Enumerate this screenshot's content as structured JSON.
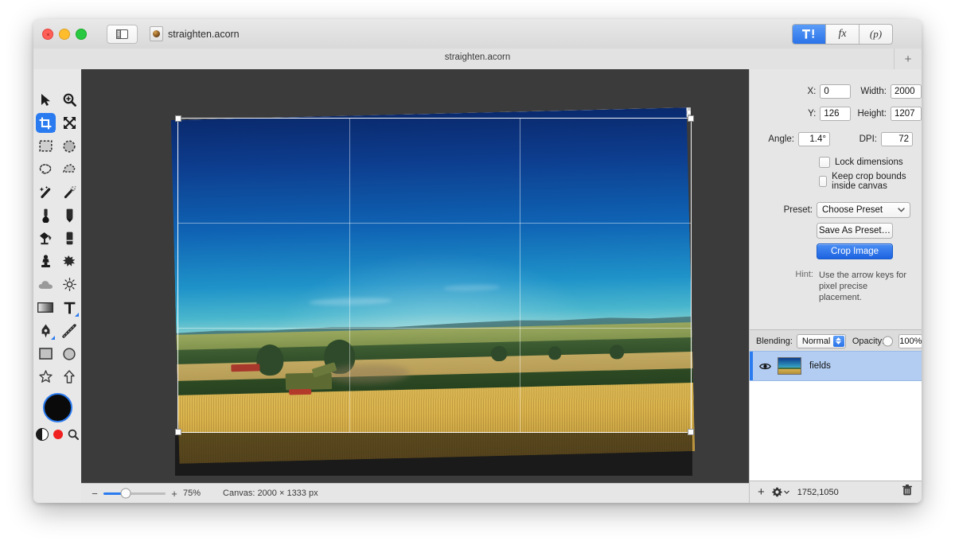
{
  "window": {
    "document_name": "straighten.acorn",
    "tab_title": "straighten.acorn",
    "add_tab_label": "+",
    "traffic_lights": [
      "close-red",
      "minimize-yellow",
      "zoom-green"
    ],
    "sidebar_toggle_icon": "sidebar-toggle-icon",
    "doc_icon": "acorn-document-icon"
  },
  "toolbar_segments": [
    {
      "name": "tools-segment",
      "glyph": "tools-icon",
      "active": true
    },
    {
      "name": "filters-segment",
      "label": "fx",
      "active": false
    },
    {
      "name": "palette-segment",
      "label": "(p)",
      "active": false
    }
  ],
  "tools": [
    {
      "name": "move-tool",
      "icon": "arrow-cursor-icon",
      "selected": false
    },
    {
      "name": "zoom-tool",
      "icon": "magnifier-plus-icon",
      "selected": false
    },
    {
      "name": "crop-tool",
      "icon": "crop-icon",
      "selected": true
    },
    {
      "name": "transform-tool",
      "icon": "four-arrows-icon",
      "selected": false
    },
    {
      "name": "rectangular-select-tool",
      "icon": "dashed-rectangle-icon",
      "selected": false
    },
    {
      "name": "elliptical-select-tool",
      "icon": "dashed-ellipse-icon",
      "selected": false
    },
    {
      "name": "lasso-tool",
      "icon": "lasso-icon",
      "selected": false
    },
    {
      "name": "polygon-lasso-tool",
      "icon": "polygon-lasso-icon",
      "selected": false
    },
    {
      "name": "magic-wand-tool",
      "icon": "magic-wand-icon",
      "selected": false
    },
    {
      "name": "instant-alpha-tool",
      "icon": "sparkle-wand-icon",
      "selected": false
    },
    {
      "name": "eyedropper-tool",
      "icon": "eyedropper-icon",
      "selected": false
    },
    {
      "name": "pencil-tool",
      "icon": "pencil-icon",
      "selected": false
    },
    {
      "name": "paint-bucket-tool",
      "icon": "paint-bucket-icon",
      "selected": false
    },
    {
      "name": "eraser-tool",
      "icon": "eraser-icon",
      "selected": false
    },
    {
      "name": "clone-stamp-tool",
      "icon": "clone-stamp-icon",
      "selected": false
    },
    {
      "name": "smudge-tool",
      "icon": "spatter-icon",
      "selected": false
    },
    {
      "name": "blur-tool",
      "icon": "cloud-icon",
      "selected": false
    },
    {
      "name": "dodge-tool",
      "icon": "sun-icon",
      "selected": false
    },
    {
      "name": "gradient-tool",
      "icon": "gradient-icon",
      "selected": false
    },
    {
      "name": "text-tool",
      "icon": "text-t-icon",
      "selected": false
    },
    {
      "name": "bezier-pen-tool",
      "icon": "pen-nib-icon",
      "selected": false
    },
    {
      "name": "line-tool",
      "icon": "line-icon",
      "selected": false
    },
    {
      "name": "rectangle-shape-tool",
      "icon": "rectangle-icon",
      "selected": false
    },
    {
      "name": "ellipse-shape-tool",
      "icon": "circle-icon",
      "selected": false
    },
    {
      "name": "star-shape-tool",
      "icon": "star-icon",
      "selected": false
    },
    {
      "name": "arrow-shape-tool",
      "icon": "up-arrow-icon",
      "selected": false
    }
  ],
  "color_well": {
    "foreground_color": "#0a0a0a",
    "ring_color": "#2a7bf0",
    "swap_icon": "black-white-swap-icon",
    "alert_icon": "red-dot-icon",
    "loupe_icon": "magnifier-icon"
  },
  "crop_panel": {
    "x": {
      "label": "X:",
      "value": "0"
    },
    "y": {
      "label": "Y:",
      "value": "126"
    },
    "width": {
      "label": "Width:",
      "value": "2000"
    },
    "height": {
      "label": "Height:",
      "value": "1207"
    },
    "angle": {
      "label": "Angle:",
      "value": "1.4°"
    },
    "dpi": {
      "label": "DPI:",
      "value": "72"
    },
    "lock_dimensions": {
      "label": "Lock dimensions",
      "checked": false
    },
    "keep_inside_canvas": {
      "label": "Keep crop bounds inside canvas",
      "checked": false
    },
    "preset": {
      "label": "Preset:",
      "value": "Choose Preset"
    },
    "save_preset_button": "Save As Preset…",
    "crop_button": "Crop Image",
    "hint_label": "Hint:",
    "hint_text": "Use the arrow keys for pixel precise placement."
  },
  "layers_panel": {
    "blending_label": "Blending:",
    "blending_value": "Normal",
    "opacity_label": "Opacity:",
    "opacity_value": "100%",
    "opacity_percent": 100,
    "layers": [
      {
        "name": "fields",
        "visible": true,
        "selected": true
      }
    ],
    "add_layer_icon": "plus-icon",
    "settings_icon": "gear-dropdown-icon",
    "coordinates": "1752,1050",
    "delete_icon": "trash-icon"
  },
  "status_bar": {
    "zoom_out_icon": "minus-icon",
    "zoom_in_icon": "plus-icon",
    "zoom_level": "75%",
    "zoom_percent": 75,
    "canvas_info": "Canvas: 2000 × 1333 px"
  },
  "canvas": {
    "image_description": "combine harvester in a golden wheat field under deep blue sky",
    "crop_overlay": "rule-of-thirds-grid",
    "rotation_degrees": -1.4
  },
  "colors": {
    "accent": "#2a7bf0",
    "window_chrome": "#e6e6e6",
    "canvas_backdrop": "#3b3b3b",
    "selection_row": "#b3cdf2"
  }
}
